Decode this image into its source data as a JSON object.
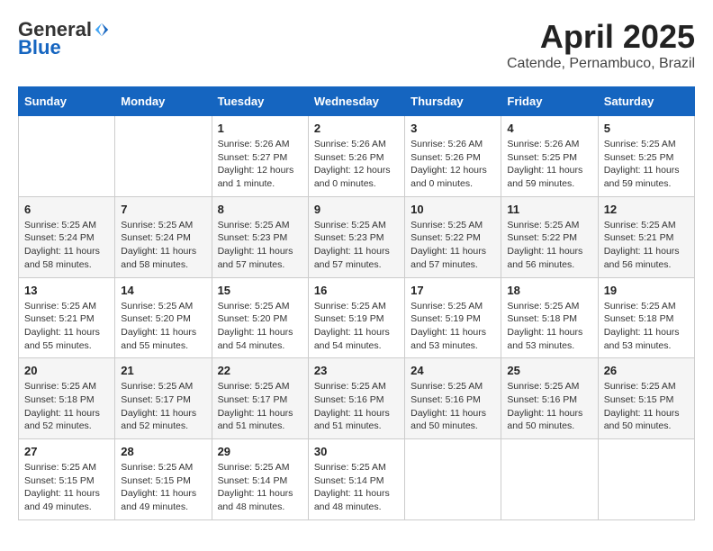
{
  "header": {
    "logo_general": "General",
    "logo_blue": "Blue",
    "month_title": "April 2025",
    "subtitle": "Catende, Pernambuco, Brazil"
  },
  "days_of_week": [
    "Sunday",
    "Monday",
    "Tuesday",
    "Wednesday",
    "Thursday",
    "Friday",
    "Saturday"
  ],
  "weeks": [
    [
      {
        "day": "",
        "info": ""
      },
      {
        "day": "",
        "info": ""
      },
      {
        "day": "1",
        "info": "Sunrise: 5:26 AM\nSunset: 5:27 PM\nDaylight: 12 hours\nand 1 minute."
      },
      {
        "day": "2",
        "info": "Sunrise: 5:26 AM\nSunset: 5:26 PM\nDaylight: 12 hours\nand 0 minutes."
      },
      {
        "day": "3",
        "info": "Sunrise: 5:26 AM\nSunset: 5:26 PM\nDaylight: 12 hours\nand 0 minutes."
      },
      {
        "day": "4",
        "info": "Sunrise: 5:26 AM\nSunset: 5:25 PM\nDaylight: 11 hours\nand 59 minutes."
      },
      {
        "day": "5",
        "info": "Sunrise: 5:25 AM\nSunset: 5:25 PM\nDaylight: 11 hours\nand 59 minutes."
      }
    ],
    [
      {
        "day": "6",
        "info": "Sunrise: 5:25 AM\nSunset: 5:24 PM\nDaylight: 11 hours\nand 58 minutes."
      },
      {
        "day": "7",
        "info": "Sunrise: 5:25 AM\nSunset: 5:24 PM\nDaylight: 11 hours\nand 58 minutes."
      },
      {
        "day": "8",
        "info": "Sunrise: 5:25 AM\nSunset: 5:23 PM\nDaylight: 11 hours\nand 57 minutes."
      },
      {
        "day": "9",
        "info": "Sunrise: 5:25 AM\nSunset: 5:23 PM\nDaylight: 11 hours\nand 57 minutes."
      },
      {
        "day": "10",
        "info": "Sunrise: 5:25 AM\nSunset: 5:22 PM\nDaylight: 11 hours\nand 57 minutes."
      },
      {
        "day": "11",
        "info": "Sunrise: 5:25 AM\nSunset: 5:22 PM\nDaylight: 11 hours\nand 56 minutes."
      },
      {
        "day": "12",
        "info": "Sunrise: 5:25 AM\nSunset: 5:21 PM\nDaylight: 11 hours\nand 56 minutes."
      }
    ],
    [
      {
        "day": "13",
        "info": "Sunrise: 5:25 AM\nSunset: 5:21 PM\nDaylight: 11 hours\nand 55 minutes."
      },
      {
        "day": "14",
        "info": "Sunrise: 5:25 AM\nSunset: 5:20 PM\nDaylight: 11 hours\nand 55 minutes."
      },
      {
        "day": "15",
        "info": "Sunrise: 5:25 AM\nSunset: 5:20 PM\nDaylight: 11 hours\nand 54 minutes."
      },
      {
        "day": "16",
        "info": "Sunrise: 5:25 AM\nSunset: 5:19 PM\nDaylight: 11 hours\nand 54 minutes."
      },
      {
        "day": "17",
        "info": "Sunrise: 5:25 AM\nSunset: 5:19 PM\nDaylight: 11 hours\nand 53 minutes."
      },
      {
        "day": "18",
        "info": "Sunrise: 5:25 AM\nSunset: 5:18 PM\nDaylight: 11 hours\nand 53 minutes."
      },
      {
        "day": "19",
        "info": "Sunrise: 5:25 AM\nSunset: 5:18 PM\nDaylight: 11 hours\nand 53 minutes."
      }
    ],
    [
      {
        "day": "20",
        "info": "Sunrise: 5:25 AM\nSunset: 5:18 PM\nDaylight: 11 hours\nand 52 minutes."
      },
      {
        "day": "21",
        "info": "Sunrise: 5:25 AM\nSunset: 5:17 PM\nDaylight: 11 hours\nand 52 minutes."
      },
      {
        "day": "22",
        "info": "Sunrise: 5:25 AM\nSunset: 5:17 PM\nDaylight: 11 hours\nand 51 minutes."
      },
      {
        "day": "23",
        "info": "Sunrise: 5:25 AM\nSunset: 5:16 PM\nDaylight: 11 hours\nand 51 minutes."
      },
      {
        "day": "24",
        "info": "Sunrise: 5:25 AM\nSunset: 5:16 PM\nDaylight: 11 hours\nand 50 minutes."
      },
      {
        "day": "25",
        "info": "Sunrise: 5:25 AM\nSunset: 5:16 PM\nDaylight: 11 hours\nand 50 minutes."
      },
      {
        "day": "26",
        "info": "Sunrise: 5:25 AM\nSunset: 5:15 PM\nDaylight: 11 hours\nand 50 minutes."
      }
    ],
    [
      {
        "day": "27",
        "info": "Sunrise: 5:25 AM\nSunset: 5:15 PM\nDaylight: 11 hours\nand 49 minutes."
      },
      {
        "day": "28",
        "info": "Sunrise: 5:25 AM\nSunset: 5:15 PM\nDaylight: 11 hours\nand 49 minutes."
      },
      {
        "day": "29",
        "info": "Sunrise: 5:25 AM\nSunset: 5:14 PM\nDaylight: 11 hours\nand 48 minutes."
      },
      {
        "day": "30",
        "info": "Sunrise: 5:25 AM\nSunset: 5:14 PM\nDaylight: 11 hours\nand 48 minutes."
      },
      {
        "day": "",
        "info": ""
      },
      {
        "day": "",
        "info": ""
      },
      {
        "day": "",
        "info": ""
      }
    ]
  ]
}
